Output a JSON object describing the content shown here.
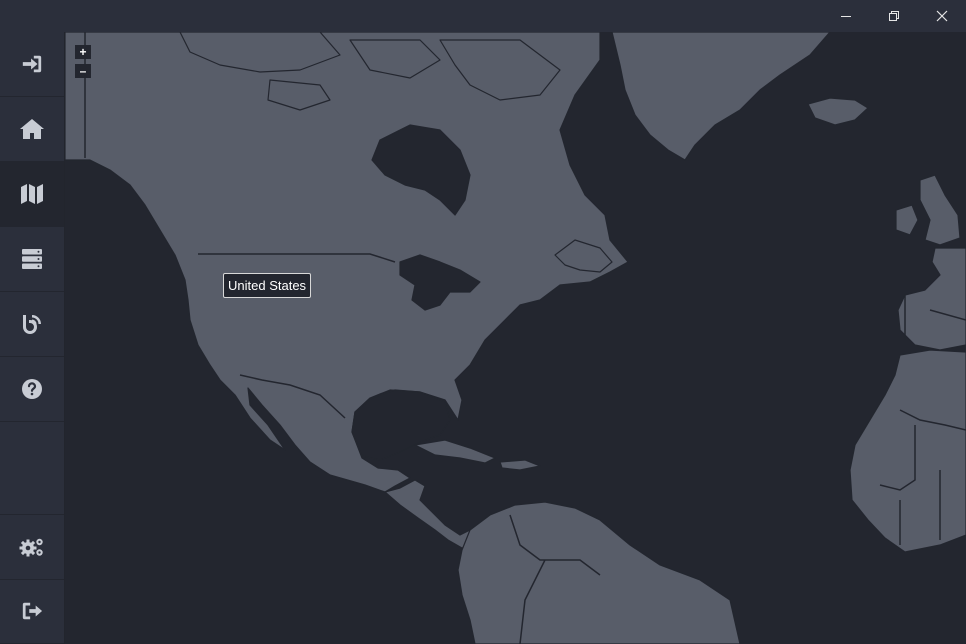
{
  "window": {
    "controls": [
      {
        "name": "minimize",
        "icon": "minimize-icon"
      },
      {
        "name": "restore",
        "icon": "restore-icon"
      },
      {
        "name": "close",
        "icon": "close-icon"
      }
    ]
  },
  "sidebar": {
    "items": [
      {
        "id": "login",
        "icon": "sign-in-icon",
        "active": false
      },
      {
        "id": "home",
        "icon": "home-icon",
        "active": false
      },
      {
        "id": "map",
        "icon": "map-icon",
        "active": true
      },
      {
        "id": "servers",
        "icon": "server-icon",
        "active": false
      },
      {
        "id": "blog",
        "icon": "blog-icon",
        "active": false
      },
      {
        "id": "help",
        "icon": "question-circle-icon",
        "active": false
      },
      {
        "id": "settings",
        "icon": "cogs-icon",
        "active": false
      },
      {
        "id": "logout",
        "icon": "sign-out-icon",
        "active": false
      }
    ]
  },
  "map": {
    "zoom_in_label": "+",
    "zoom_out_label": "–",
    "tooltip": "United States",
    "colors": {
      "ocean": "#23262f",
      "land": "#585d69",
      "border": "#23262f"
    }
  }
}
